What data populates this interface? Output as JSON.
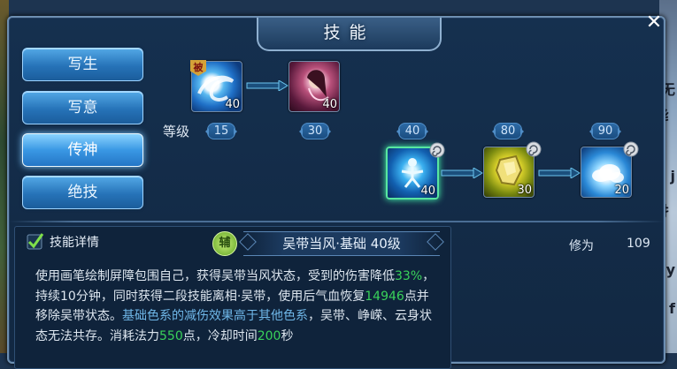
{
  "window": {
    "title": "技能",
    "close_glyph": "✕"
  },
  "tabs": [
    {
      "label": "写生",
      "active": false
    },
    {
      "label": "写意",
      "active": false
    },
    {
      "label": "传神",
      "active": true
    },
    {
      "label": "绝技",
      "active": false
    }
  ],
  "skill_tree": {
    "level_label": "等级",
    "row1": [
      {
        "icon": "blue-wave-skill-icon",
        "level": "40",
        "badge": "被"
      },
      {
        "icon": "lady-portrait-skill-icon",
        "level": "40"
      }
    ],
    "row2": [
      {
        "icon": "meditating-figure-skill-icon",
        "level": "40",
        "selected": true
      },
      {
        "icon": "golden-rock-skill-icon",
        "level": "30"
      },
      {
        "icon": "cloud-skill-icon",
        "level": "20"
      }
    ],
    "level_requirements": [
      "15",
      "30",
      "40",
      "80",
      "90"
    ]
  },
  "detail": {
    "title": "技能详情",
    "type_badge": "辅",
    "skill_name": "吴带当风·基础 40级",
    "xiuwei_label": "修为",
    "xiuwei_value": "109",
    "description": {
      "p1": "使用画笔绘制屏障包围自己，获得吴带当风状态，受到的伤害降低",
      "v1": "33%",
      "p2": "，持续10分钟，同时获得二段技能离相·吴带，使用后气血恢复",
      "v2": "14946",
      "p3": "点并移除吴带状态。",
      "b1": "基础色系的减伤效果高于其他色系",
      "p4": "，吴带、峥嵘、云身状态无法共存。消耗法力",
      "v3": "550",
      "p5": "点，冷却时间",
      "v4": "200",
      "p6": "秒"
    }
  },
  "side_fragments": [
    "无",
    "纟",
    "j",
    "扌",
    "y",
    "f"
  ],
  "colors": {
    "accent_green": "#39d25a",
    "accent_blue": "#6fb7e8",
    "tab_blue": "#3a98e4"
  }
}
